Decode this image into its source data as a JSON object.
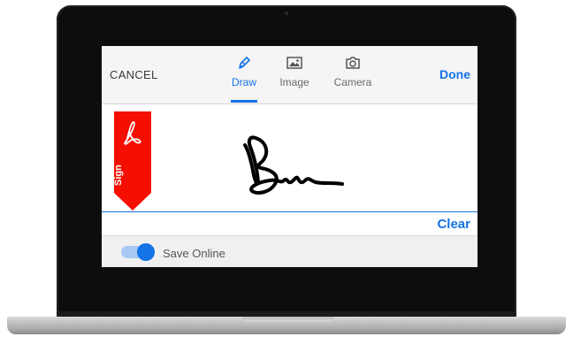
{
  "toolbar": {
    "cancel_label": "CANCEL",
    "done_label": "Done",
    "tabs": [
      {
        "label": "Draw",
        "icon": "pen-icon",
        "active": true
      },
      {
        "label": "Image",
        "icon": "image-icon",
        "active": false
      },
      {
        "label": "Camera",
        "icon": "camera-icon",
        "active": false
      }
    ]
  },
  "canvas": {
    "ribbon_label": "Sign",
    "clear_label": "Clear",
    "signature": "handwritten-signature"
  },
  "footer": {
    "save_online_label": "Save Online",
    "save_online_enabled": true
  },
  "colors": {
    "accent": "#1473e6",
    "ribbon_red": "#f40f02"
  }
}
